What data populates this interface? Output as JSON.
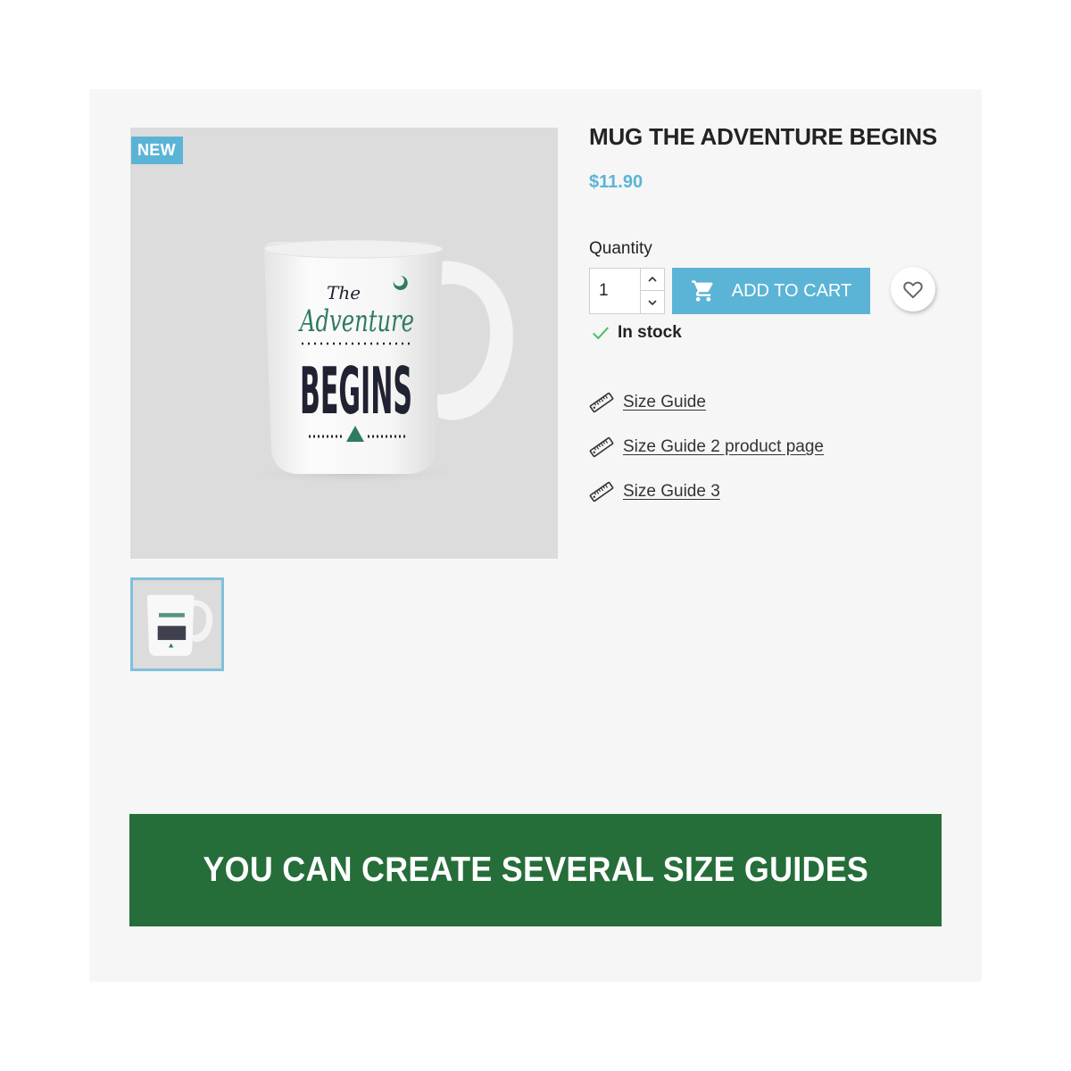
{
  "product": {
    "badge": "NEW",
    "title": "MUG THE ADVENTURE BEGINS",
    "price": "$11.90",
    "image_alt": "White mug with 'The Adventure Begins' print",
    "mug_print": {
      "line1": "The",
      "line2": "Adventure",
      "line3": "BEGINS"
    }
  },
  "purchase": {
    "quantity_label": "Quantity",
    "quantity_value": "1",
    "add_to_cart_label": "ADD TO CART",
    "stock_status": "In stock"
  },
  "size_guides": [
    {
      "label": "Size Guide"
    },
    {
      "label": "Size Guide 2 product page"
    },
    {
      "label": "Size Guide 3"
    }
  ],
  "banner": {
    "text": "YOU CAN CREATE SEVERAL SIZE GUIDES"
  },
  "colors": {
    "accent": "#5bb4d6",
    "banner_bg": "#256d39",
    "page_bg": "#f6f6f6",
    "stock_check": "#4cbb6c",
    "mug_green": "#2f7a62",
    "mug_dark": "#1f2230"
  }
}
